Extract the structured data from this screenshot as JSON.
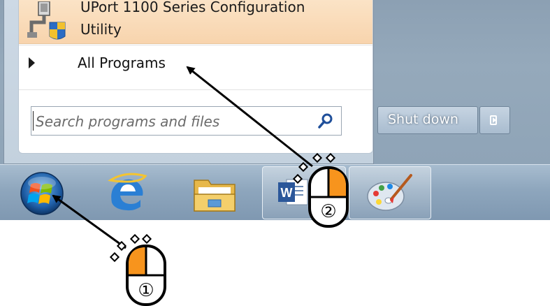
{
  "start_menu": {
    "pinned_app": {
      "title_line1": "UPort 1100 Series Configuration",
      "title_line2": "Utility"
    },
    "all_programs_label": "All Programs",
    "search_placeholder": "Search programs and files",
    "shutdown_label": "Shut down"
  },
  "taskbar": {
    "items": [
      {
        "name": "start-orb",
        "icon": "windows-logo-icon"
      },
      {
        "name": "internet-explorer",
        "icon": "internet-explorer-icon"
      },
      {
        "name": "windows-explorer",
        "icon": "folder-icon"
      },
      {
        "name": "microsoft-word",
        "icon": "word-icon",
        "letter": "W"
      },
      {
        "name": "paint",
        "icon": "paint-palette-icon"
      }
    ]
  },
  "annotations": {
    "step1": "①",
    "step2": "②"
  },
  "colors": {
    "mouse_button": "#f7941d",
    "arrow": "#000000",
    "pinned_highlight": "#f8d4ad"
  }
}
